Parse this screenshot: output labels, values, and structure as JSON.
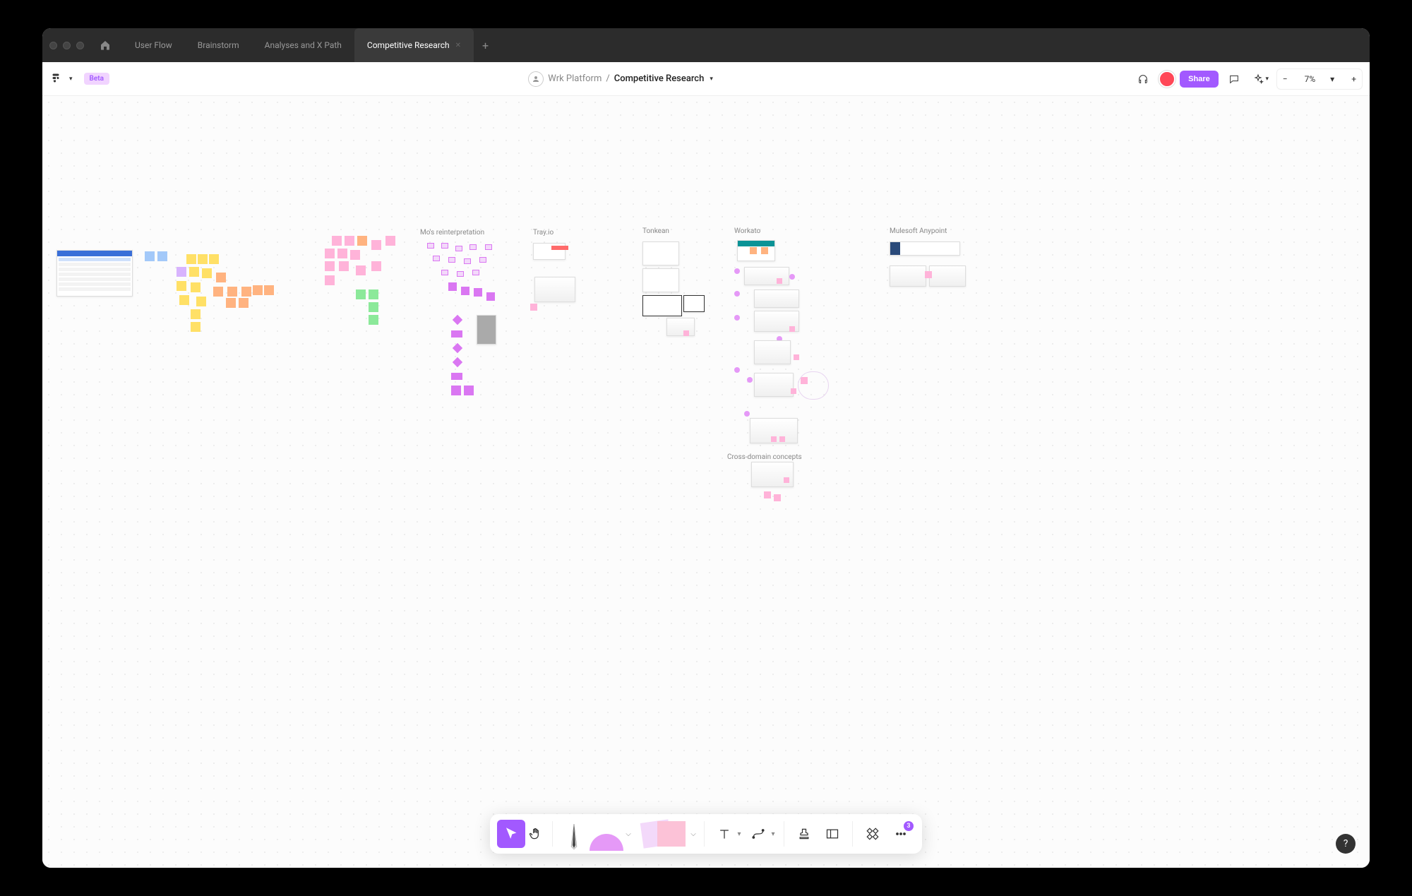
{
  "titlebar": {
    "tabs": [
      "User Flow",
      "Brainstorm",
      "Analyses and X Path",
      "Competitive Research"
    ],
    "active_tab_index": 3
  },
  "toolbar": {
    "beta_label": "Beta",
    "team_name": "Wrk Platform",
    "file_name": "Competitive Research",
    "share_label": "Share",
    "zoom_value": "7%"
  },
  "canvas": {
    "frames": {
      "mo_reinterpretation": "Mo's reinterpretation",
      "tray": "Tray.io",
      "tonkean": "Tonkean",
      "workato": "Workato",
      "mulesoft": "Mulesoft Anypoint",
      "abstraction": "Cross-domain concepts"
    }
  },
  "bottom_toolbar": {
    "more_count": "3"
  },
  "help_label": "?"
}
